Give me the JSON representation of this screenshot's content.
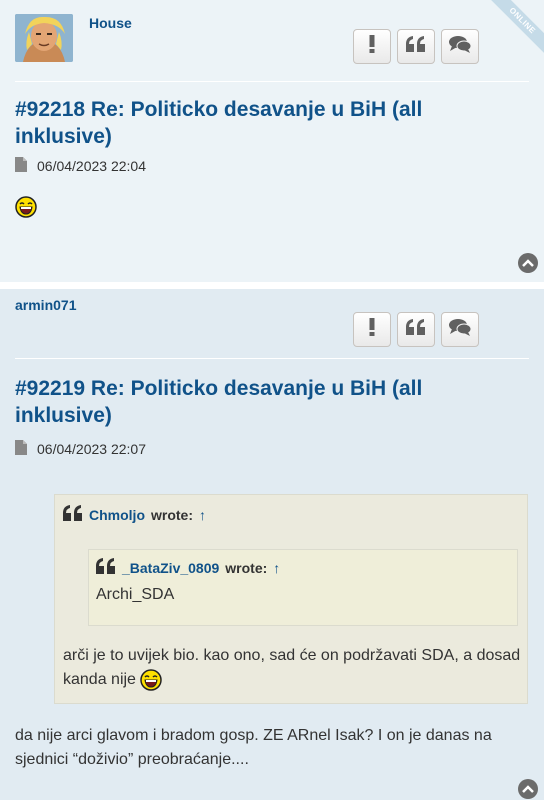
{
  "posts": [
    {
      "username": "House",
      "online_label": "ONLINE",
      "title": "#92218 Re: Politicko desavanje u BiH (all inklusive)",
      "date": "06/04/2023 22:04",
      "actions": [
        "report-icon",
        "quote-icon",
        "comment-icon"
      ]
    },
    {
      "username": "armin071",
      "title": "#92219 Re: Politicko desavanje u BiH (all inklusive)",
      "date": "06/04/2023 22:07",
      "quote": {
        "author": "Chmoljo",
        "wrote": "wrote:",
        "arrow": "↑",
        "nested": {
          "author": "_BataZiv_0809",
          "wrote": "wrote:",
          "arrow": "↑",
          "text": "Archi_SDA"
        },
        "text": "arči je to uvijek bio. kao ono, sad će on podržavati SDA, a dosad kanda nije"
      },
      "body": "da nije arci glavom i bradom gosp. ZE ARnel Isak? I on je danas na sjednici “doživio” preobraćanje...."
    }
  ],
  "colors": {
    "link": "#105289",
    "post_bg_1": "#ecf3f7",
    "post_bg_2": "#e1ebf2",
    "quote_bg": "#ebeadd"
  }
}
